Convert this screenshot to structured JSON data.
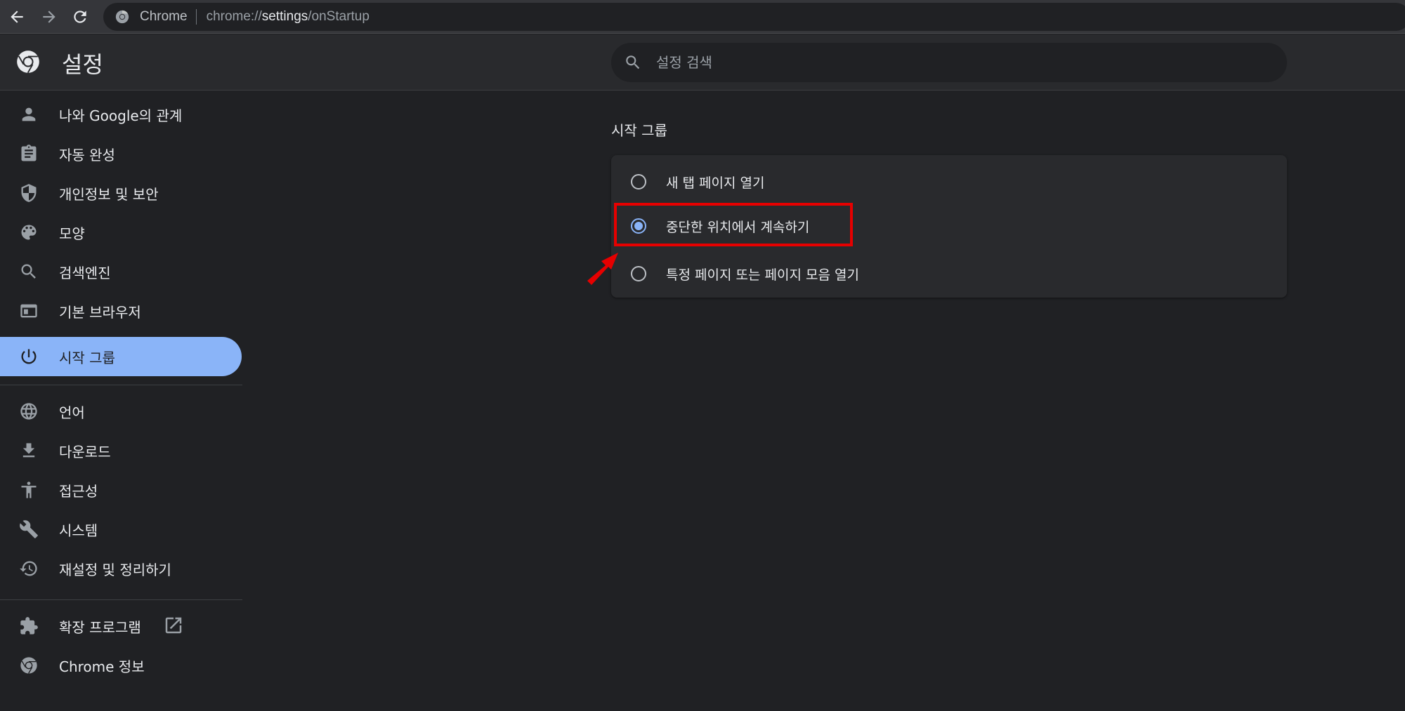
{
  "browser": {
    "back_icon": "arrow-back-icon",
    "forward_icon": "arrow-forward-icon",
    "reload_icon": "reload-icon",
    "chip_label": "Chrome",
    "url_prefix": "chrome://",
    "url_host": "settings",
    "url_path": "/onStartup"
  },
  "header": {
    "title": "설정",
    "search_placeholder": "설정 검색"
  },
  "sidebar": {
    "items": [
      {
        "label": "나와 Google의 관계",
        "icon": "person-icon"
      },
      {
        "label": "자동 완성",
        "icon": "clipboard-icon"
      },
      {
        "label": "개인정보 및 보안",
        "icon": "shield-icon"
      },
      {
        "label": "모양",
        "icon": "palette-icon"
      },
      {
        "label": "검색엔진",
        "icon": "search-icon"
      },
      {
        "label": "기본 브라우저",
        "icon": "browser-window-icon"
      },
      {
        "label": "시작 그룹",
        "icon": "power-icon",
        "active": true
      },
      {
        "label": "언어",
        "icon": "globe-icon"
      },
      {
        "label": "다운로드",
        "icon": "download-icon"
      },
      {
        "label": "접근성",
        "icon": "accessibility-icon"
      },
      {
        "label": "시스템",
        "icon": "wrench-icon"
      },
      {
        "label": "재설정 및 정리하기",
        "icon": "history-reset-icon"
      },
      {
        "label": "확장 프로그램",
        "icon": "puzzle-icon"
      },
      {
        "label": "Chrome 정보",
        "icon": "chrome-logo-icon"
      }
    ]
  },
  "main": {
    "section_title": "시작 그룹",
    "options": [
      {
        "label": "새 탭 페이지 열기",
        "checked": false
      },
      {
        "label": "중단한 위치에서 계속하기",
        "checked": true
      },
      {
        "label": "특정 페이지 또는 페이지 모음 열기",
        "checked": false
      }
    ]
  },
  "colors": {
    "accent": "#8ab4f8",
    "background": "#202124",
    "card": "#292a2d",
    "annotation_red": "#e60000"
  }
}
